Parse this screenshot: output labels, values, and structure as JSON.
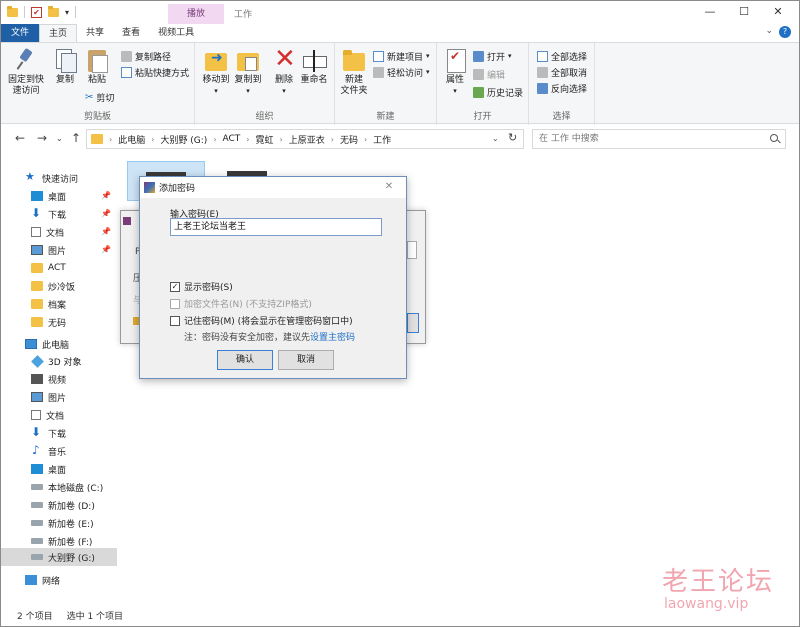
{
  "titlebar": {
    "context_tab": "播放",
    "title": "工作",
    "minimize": "—",
    "maximize": "☐",
    "close": "✕"
  },
  "tabs": {
    "file": "文件",
    "home": "主页",
    "share": "共享",
    "view": "查看",
    "video_tools": "视频工具",
    "help": "?"
  },
  "ribbon": {
    "clipboard": {
      "pin": "固定到快\n速访问",
      "copy": "复制",
      "paste": "粘贴",
      "copy_path": "复制路径",
      "paste_shortcut": "粘贴快捷方式",
      "cut": "剪切",
      "label": "剪贴板"
    },
    "organize": {
      "move_to": "移动到",
      "copy_to": "复制到",
      "delete": "删除",
      "rename": "重命名",
      "label": "组织"
    },
    "new": {
      "new_folder": "新建\n文件夹",
      "new_item": "新建项目",
      "easy_access": "轻松访问",
      "label": "新建"
    },
    "open": {
      "properties": "属性",
      "open": "打开",
      "edit": "编辑",
      "history": "历史记录",
      "label": "打开"
    },
    "select": {
      "select_all": "全部选择",
      "select_none": "全部取消",
      "invert": "反向选择",
      "label": "选择"
    }
  },
  "address": {
    "crumbs": [
      "此电脑",
      "大别野 (G:)",
      "ACT",
      "霓虹",
      "上原亚衣",
      "无码",
      "工作"
    ],
    "search_placeholder": "在 工作 中搜索"
  },
  "sidebar": {
    "items": [
      {
        "label": "快速访问",
        "icon": "star-icon"
      },
      {
        "label": "桌面",
        "icon": "desktop-icon"
      },
      {
        "label": "下载",
        "icon": "download-icon"
      },
      {
        "label": "文档",
        "icon": "document-icon"
      },
      {
        "label": "图片",
        "icon": "picture-icon"
      },
      {
        "label": "ACT",
        "icon": "folder-icon"
      },
      {
        "label": "炒冷饭",
        "icon": "folder-icon"
      },
      {
        "label": "档案",
        "icon": "folder-icon"
      },
      {
        "label": "无码",
        "icon": "folder-icon"
      },
      {
        "label": "此电脑",
        "icon": "computer-icon"
      },
      {
        "label": "3D 对象",
        "icon": "3d-objects-icon"
      },
      {
        "label": "视频",
        "icon": "video-icon"
      },
      {
        "label": "图片",
        "icon": "picture-icon"
      },
      {
        "label": "文档",
        "icon": "document-icon"
      },
      {
        "label": "下载",
        "icon": "download-icon"
      },
      {
        "label": "音乐",
        "icon": "music-icon"
      },
      {
        "label": "桌面",
        "icon": "desktop-icon"
      },
      {
        "label": "本地磁盘 (C:)",
        "icon": "drive-icon"
      },
      {
        "label": "新加卷 (D:)",
        "icon": "drive-icon"
      },
      {
        "label": "新加卷 (E:)",
        "icon": "drive-icon"
      },
      {
        "label": "新加卷 (F:)",
        "icon": "drive-icon"
      },
      {
        "label": "大别野 (G:)",
        "icon": "drive-icon"
      },
      {
        "label": "网络",
        "icon": "network-icon"
      }
    ]
  },
  "status": {
    "count": "2 个项目",
    "selected": "选中 1 个项目"
  },
  "back_dialog": {
    "frag1": "P",
    "frag2": "压",
    "frag3": "与"
  },
  "dialog": {
    "title": "添加密码",
    "close": "✕",
    "label": "输入密码(E)",
    "password_value": "上老王论坛当老王",
    "show_password": "显示密码(S)",
    "show_password_checked": "✓",
    "encrypt_names": "加密文件名(N) (不支持ZIP格式)",
    "remember": "记住密码(M) (将会显示在管理密码窗口中)",
    "note_prefix": "注：密码没有安全加密，建议先",
    "note_link": "设置主密码",
    "ok": "确认",
    "cancel": "取消"
  },
  "watermark": {
    "cn": "老王论坛",
    "url": "laowang.vip"
  }
}
